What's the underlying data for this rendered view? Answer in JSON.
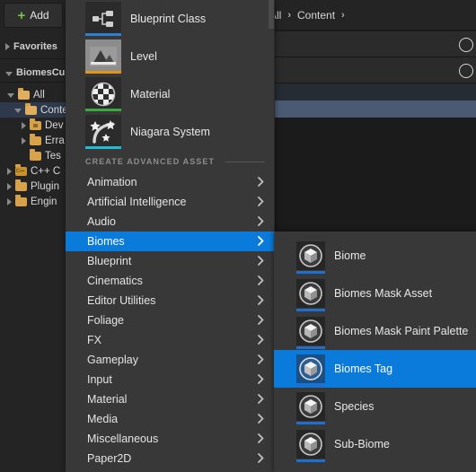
{
  "toolbar": {
    "add_button_label": "Add",
    "add_icon": "plus-icon"
  },
  "breadcrumb": {
    "items": [
      "All",
      "Content"
    ],
    "separator": "›"
  },
  "left_panel": {
    "sections": [
      {
        "label": "Favorites",
        "expanded": false
      },
      {
        "label": "BiomesCu",
        "expanded": true
      }
    ],
    "tree": [
      {
        "label": "All",
        "indent": 0,
        "icon": "folder-icon",
        "expanded": true,
        "selected": false
      },
      {
        "label": "Conte",
        "indent": 1,
        "icon": "folder-icon",
        "expanded": true,
        "selected": true
      },
      {
        "label": "Dev",
        "indent": 2,
        "icon": "folder-dev-icon",
        "expanded": false,
        "selected": false
      },
      {
        "label": "Erra",
        "indent": 2,
        "icon": "folder-icon",
        "expanded": false,
        "selected": false
      },
      {
        "label": "Tes",
        "indent": 2,
        "icon": "folder-icon",
        "expanded": null,
        "selected": false
      },
      {
        "label": "C++ C",
        "indent": 0,
        "icon": "folder-cpp-icon",
        "expanded": false,
        "selected": false
      },
      {
        "label": "Plugin",
        "indent": 0,
        "icon": "folder-icon",
        "expanded": false,
        "selected": false
      },
      {
        "label": "Engin",
        "indent": 0,
        "icon": "folder-icon",
        "expanded": false,
        "selected": false
      }
    ]
  },
  "menu": {
    "basic_assets": [
      {
        "label": "Blueprint Class",
        "icon": "blueprint-class-icon",
        "accent": "#2b7fd4"
      },
      {
        "label": "Level",
        "icon": "level-icon",
        "accent": "#e2931a"
      },
      {
        "label": "Material",
        "icon": "material-icon",
        "accent": "#3da83d"
      },
      {
        "label": "Niagara System",
        "icon": "niagara-system-icon",
        "accent": "#1fbdd4"
      }
    ],
    "section_header": "CREATE ADVANCED ASSET",
    "categories": [
      {
        "label": "Animation",
        "has_submenu": true,
        "active": false
      },
      {
        "label": "Artificial Intelligence",
        "has_submenu": true,
        "active": false
      },
      {
        "label": "Audio",
        "has_submenu": true,
        "active": false
      },
      {
        "label": "Biomes",
        "has_submenu": true,
        "active": true
      },
      {
        "label": "Blueprint",
        "has_submenu": true,
        "active": false
      },
      {
        "label": "Cinematics",
        "has_submenu": true,
        "active": false
      },
      {
        "label": "Editor Utilities",
        "has_submenu": true,
        "active": false
      },
      {
        "label": "Foliage",
        "has_submenu": true,
        "active": false
      },
      {
        "label": "FX",
        "has_submenu": true,
        "active": false
      },
      {
        "label": "Gameplay",
        "has_submenu": true,
        "active": false
      },
      {
        "label": "Input",
        "has_submenu": true,
        "active": false
      },
      {
        "label": "Material",
        "has_submenu": true,
        "active": false
      },
      {
        "label": "Media",
        "has_submenu": true,
        "active": false
      },
      {
        "label": "Miscellaneous",
        "has_submenu": true,
        "active": false
      },
      {
        "label": "Paper2D",
        "has_submenu": true,
        "active": false
      }
    ]
  },
  "submenu": {
    "parent": "Biomes",
    "items": [
      {
        "label": "Biome",
        "icon": "cube-asset-icon",
        "active": false
      },
      {
        "label": "Biomes Mask Asset",
        "icon": "cube-asset-icon",
        "active": false
      },
      {
        "label": "Biomes Mask Paint Palette",
        "icon": "cube-asset-icon",
        "active": false
      },
      {
        "label": "Biomes Tag",
        "icon": "cube-asset-icon",
        "active": true
      },
      {
        "label": "Species",
        "icon": "cube-asset-icon",
        "active": false
      },
      {
        "label": "Sub-Biome",
        "icon": "cube-asset-icon",
        "active": false
      }
    ]
  },
  "colors": {
    "menu_bg": "#383838",
    "highlight_blue": "#0a7bdb",
    "panel_bg": "#242424",
    "folder_orange": "#d8a24a",
    "add_green": "#7ec24a"
  }
}
